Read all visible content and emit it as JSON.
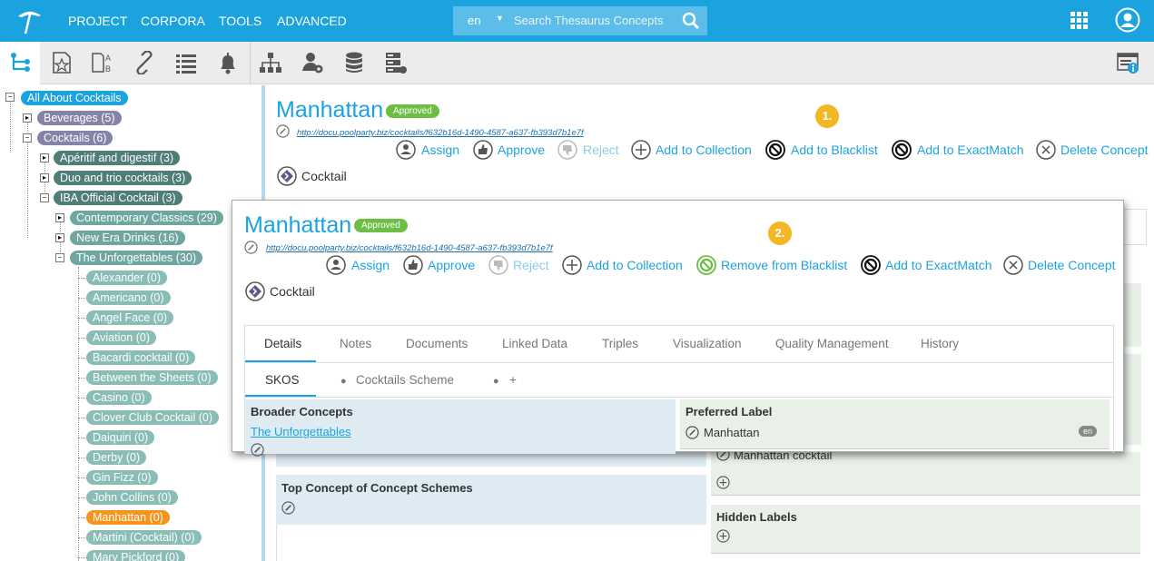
{
  "topbar": {
    "menu": [
      "PROJECT",
      "CORPORA",
      "TOOLS",
      "ADVANCED"
    ],
    "search": {
      "lang": "en",
      "placeholder": "Search Thesaurus Concepts"
    }
  },
  "toolbar": {
    "icons": [
      "hierarchy-tree-icon",
      "favorites-icon",
      "abc-mapping-icon",
      "link-icon",
      "list-icon",
      "notification-bell-icon",
      "org-chart-icon",
      "user-settings-icon",
      "database-icon",
      "server-icon",
      "info-panel-icon"
    ]
  },
  "tree": {
    "root": "All About Cocktails",
    "beverages": "Beverages (5)",
    "cocktails": "Cocktails (6)",
    "aperitif": "Apéritif and digestif (3)",
    "duo": "Duo and trio cocktails (3)",
    "iba": "IBA Official Cocktail (3)",
    "contemporary": "Contemporary Classics (29)",
    "newera": "New Era Drinks (16)",
    "unforgettables": "The Unforgettables (30)",
    "leaves": [
      "Alexander (0)",
      "Americano (0)",
      "Angel Face (0)",
      "Aviation (0)",
      "Bacardi cocktail (0)",
      "Between the Sheets (0)",
      "Casino (0)",
      "Clover Club Cocktail (0)",
      "Daiquiri (0)",
      "Derby (0)",
      "Gin Fizz (0)",
      "John Collins (0)",
      "Manhattan (0)",
      "Martini (Cocktail) (0)",
      "Mary Pickford (0)"
    ]
  },
  "concept": {
    "title": "Manhattan",
    "status": "Approved",
    "uri": "http://docu.poolparty.biz/cocktails/f632b16d-1490-4587-a637-fb393d7b1e7f",
    "type": "Cocktail",
    "callout1": "1.",
    "actions": [
      "Assign",
      "Approve",
      "Reject",
      "Add to Collection",
      "Add to Blacklist",
      "Add to ExactMatch",
      "Delete Concept"
    ]
  },
  "overlay": {
    "title": "Manhattan",
    "status": "Approved",
    "uri": "http://docu.poolparty.biz/cocktails/f632b16d-1490-4587-a637-fb393d7b1e7f",
    "type": "Cocktail",
    "callout2": "2.",
    "actions": [
      "Assign",
      "Approve",
      "Reject",
      "Add to Collection",
      "Remove from Blacklist",
      "Add to ExactMatch",
      "Delete Concept"
    ],
    "tabs": [
      "Details",
      "Notes",
      "Documents",
      "Linked Data",
      "Triples",
      "Visualization",
      "Quality Management",
      "History"
    ],
    "subtabs": [
      "SKOS",
      "Cocktails Scheme",
      "+"
    ],
    "broader_header": "Broader Concepts",
    "broader_link": "The Unforgettables",
    "preferred_header": "Preferred Label",
    "preferred_value": "Manhattan",
    "preferred_lang": "en"
  },
  "background": {
    "alt_label": "Manhattan cocktail",
    "top_concept_header": "Top Concept of Concept Schemes",
    "hidden_labels_header": "Hidden Labels"
  },
  "colors": {
    "brand": "#1ba3e0",
    "approved": "#6cbf44",
    "callout": "#f2b824",
    "selected": "#f7941d",
    "level1": "#8583a8",
    "level2": "#4f7d78",
    "level3": "#6fa7a0",
    "leaf": "#8abdb6"
  }
}
